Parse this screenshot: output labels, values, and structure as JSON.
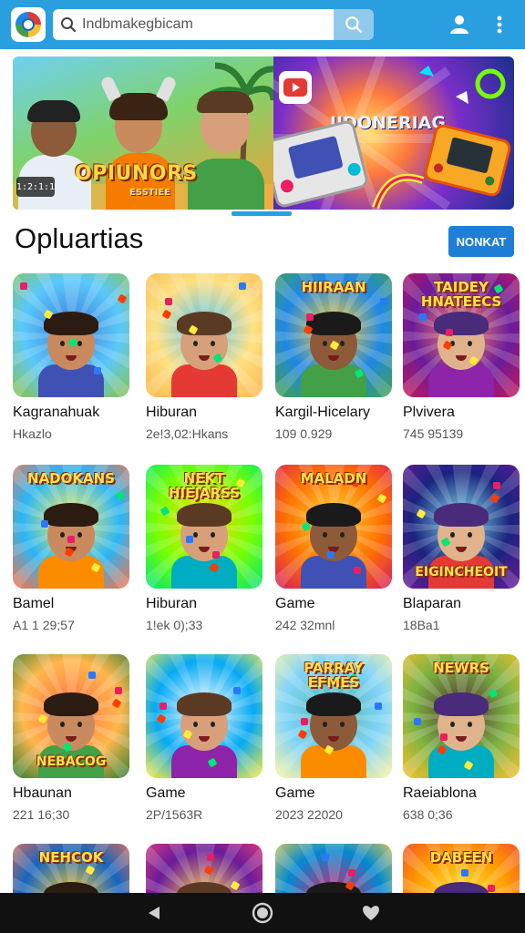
{
  "app": {
    "logo_icon": "app-logo-icon",
    "colors": {
      "topbar": "#2a9fe0",
      "accent": "#1f7fd6",
      "navbar": "#111111"
    }
  },
  "search": {
    "value": "Indbmakegbicam",
    "icon": "search-icon",
    "button_icon": "search-icon"
  },
  "top_actions": {
    "profile_icon": "person-icon",
    "menu_icon": "more-vertical-icon"
  },
  "banner": {
    "left_title": "OPIUNORS",
    "left_subtitle": "ESSTIEE",
    "badge": "1:2:1:1",
    "right_title": "IIDONERIAG",
    "play_icon": "play-icon"
  },
  "section": {
    "title": "Opluartias",
    "button": "NONKAT"
  },
  "items": [
    {
      "title": "Kagranahuak",
      "meta": "Hkazlo",
      "art": ""
    },
    {
      "title": "Hiburan",
      "meta": "2e!3,02:Hkans",
      "art": ""
    },
    {
      "title": "Kargil-Hicelary",
      "meta": "109 0.929",
      "art": "HIIRAAN"
    },
    {
      "title": "Plvivera",
      "meta": "745 95139",
      "art": "TAIDEY HNATEECS"
    },
    {
      "title": "Bamel",
      "meta": "A1 1 29;57",
      "art": "NADOKANS"
    },
    {
      "title": "Hiburan",
      "meta": "1!ek 0);33",
      "art": "NEKT HIEJARSS"
    },
    {
      "title": "Game",
      "meta": "242 32mnl",
      "art": "MALADN"
    },
    {
      "title": "Blaparan",
      "meta": "18Ba1",
      "art": "EIGINCHEOIT"
    },
    {
      "title": "Hbaunan",
      "meta": "221 16;30",
      "art": "NEBACOG"
    },
    {
      "title": "Game",
      "meta": "2P/1563R",
      "art": ""
    },
    {
      "title": "Game",
      "meta": "2023 22020",
      "art": "PARRAY EFMES"
    },
    {
      "title": "Raeiablona",
      "meta": "638 0;36",
      "art": "NEWRS"
    },
    {
      "title": "",
      "meta": "",
      "art": "NEHCOK"
    },
    {
      "title": "",
      "meta": "",
      "art": ""
    },
    {
      "title": "",
      "meta": "",
      "art": ""
    },
    {
      "title": "",
      "meta": "",
      "art": "DABEEN"
    }
  ],
  "navbar": {
    "back_icon": "back-triangle-icon",
    "home_icon": "home-circle-icon",
    "favorite_icon": "heart-icon"
  }
}
